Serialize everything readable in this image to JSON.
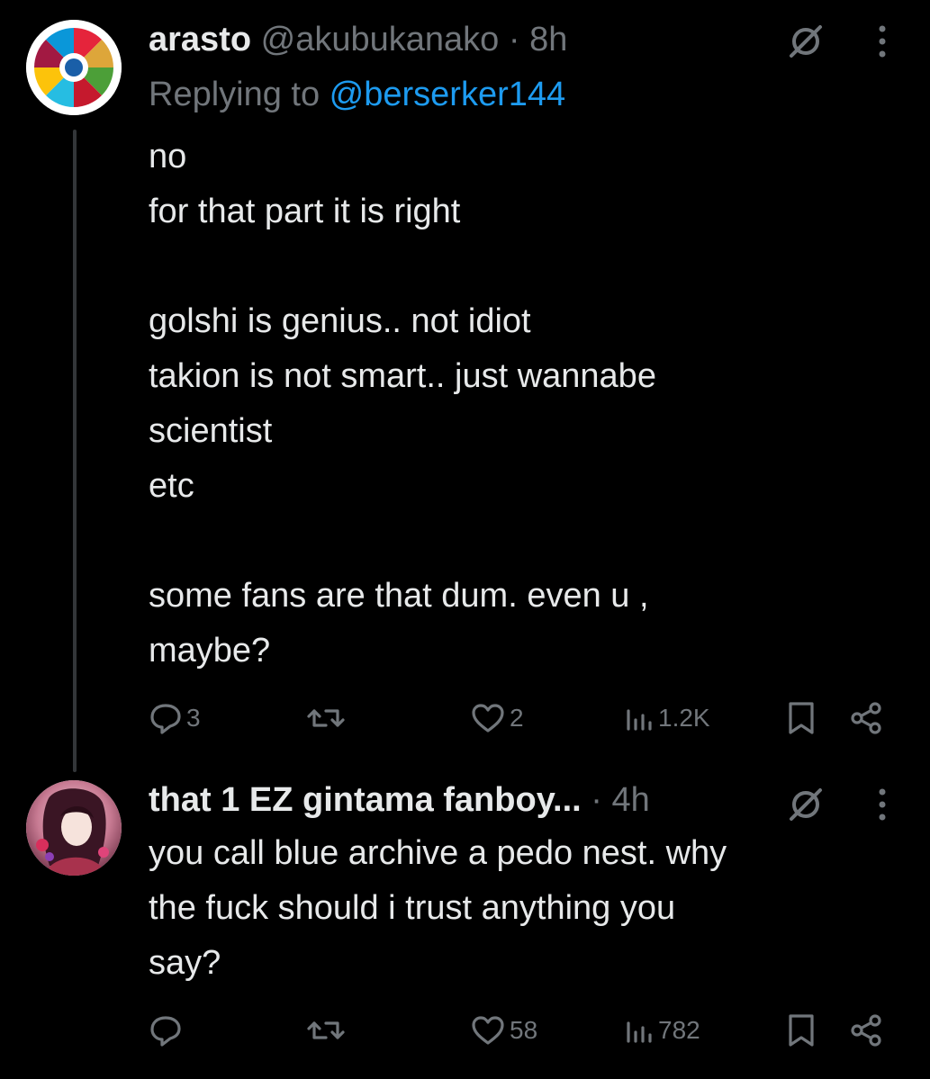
{
  "tweets": [
    {
      "name": "arasto",
      "handle": "@akubukanako",
      "separator": "·",
      "time": "8h",
      "reply_prefix": "Replying to ",
      "reply_handle": "@berserker144",
      "lines": [
        "no",
        "for that part it is right",
        "",
        "golshi is genius.. not idiot",
        "takion is not smart.. just wannabe",
        "scientist",
        "etc",
        "",
        "some fans are that dum. even u ,",
        "maybe?"
      ],
      "replies": "3",
      "reposts": "",
      "likes": "2",
      "views": "1.2K"
    },
    {
      "name": "that 1 EZ gintama fanboy...",
      "separator": "·",
      "time": "4h",
      "lines": [
        "you call blue archive a pedo nest. why",
        "the fuck should i trust anything you",
        "say?"
      ],
      "replies": "",
      "reposts": "",
      "likes": "58",
      "views": "782"
    }
  ],
  "icons": {
    "grok": "grok-icon",
    "more": "more-icon",
    "reply": "reply-icon",
    "repost": "repost-icon",
    "like": "like-icon",
    "views": "views-icon",
    "bookmark": "bookmark-icon",
    "share": "share-icon"
  },
  "colors": {
    "background": "#000000",
    "text": "#e7e9ea",
    "muted": "#71767b",
    "link": "#1d9bf0",
    "thread_line": "#333639"
  }
}
